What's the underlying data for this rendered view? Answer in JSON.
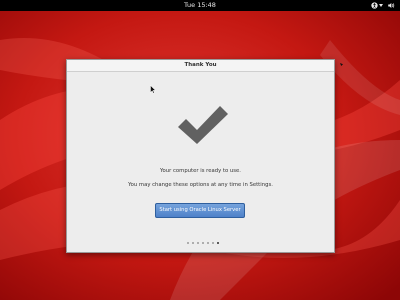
{
  "topbar": {
    "clock": "Tue 15:48",
    "a11y_icon": "accessibility-icon",
    "volume_icon": "volume-icon"
  },
  "dialog": {
    "title": "Thank You",
    "icon": "checkmark-icon",
    "ready_text": "Your computer is ready to use.",
    "settings_text": "You may change these options at any time in Settings.",
    "start_button_label": "Start using Oracle Linux Server",
    "pager": {
      "total_pages": 7,
      "current_page": 7
    }
  },
  "colors": {
    "desktop_red": "#b50d0d",
    "topbar": "#000000",
    "button_blue": "#5b8dd3",
    "check_gray": "#616161"
  }
}
